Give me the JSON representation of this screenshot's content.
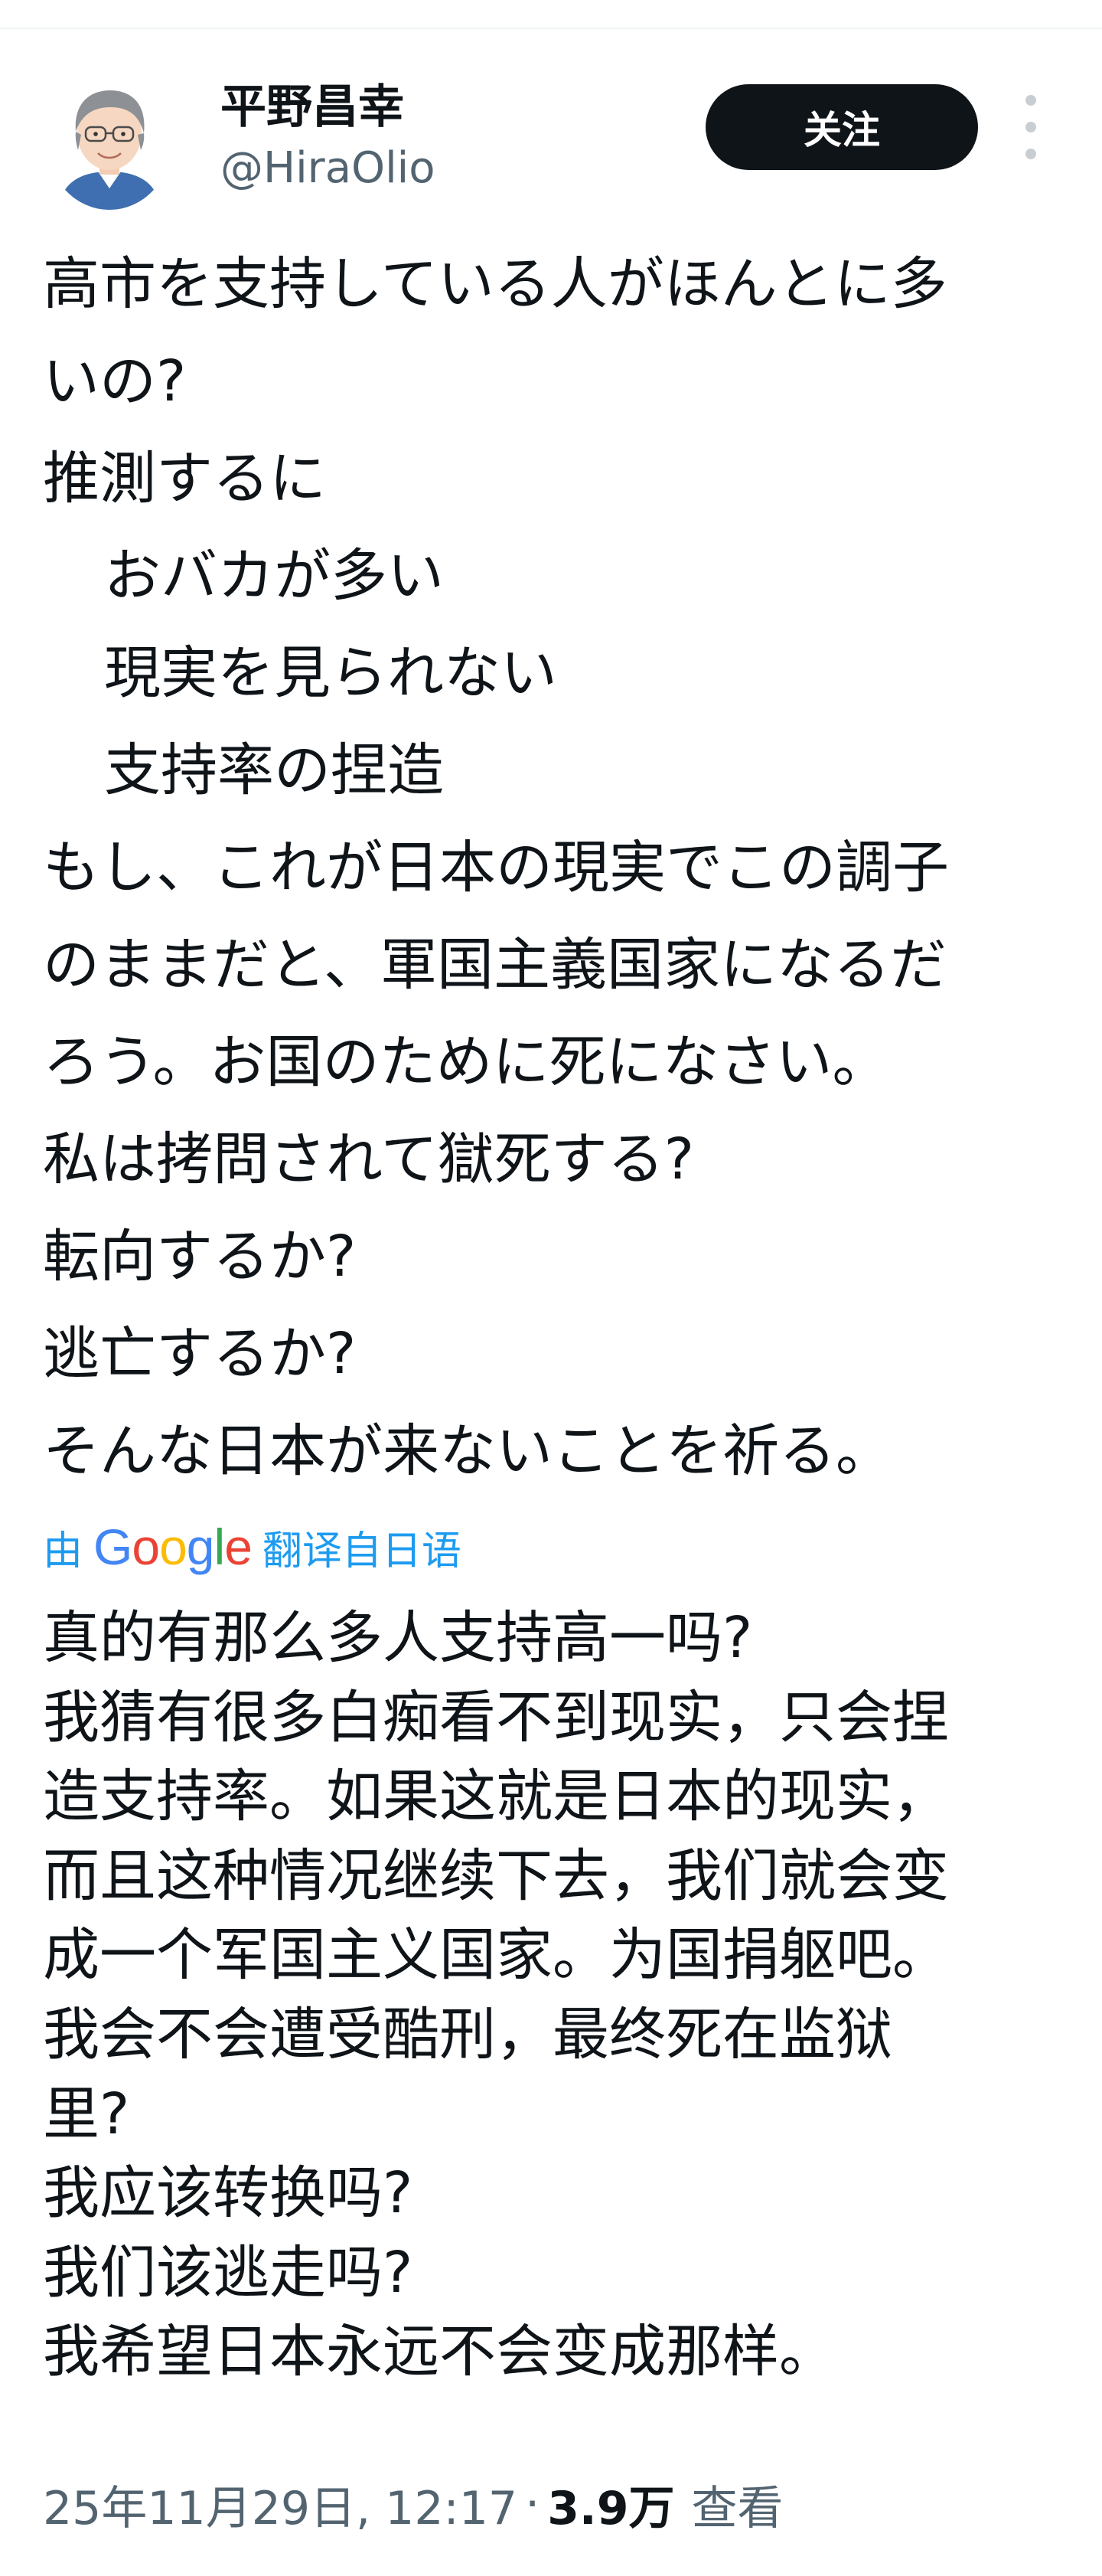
{
  "author": {
    "display_name": "平野昌幸",
    "handle": "@HiraOlio"
  },
  "actions": {
    "follow_label": "关注"
  },
  "post": {
    "original_lines": [
      {
        "text": "高市を支持している人がほんとに多",
        "indent": false
      },
      {
        "text": "いの?",
        "indent": false
      },
      {
        "text": "推測するに",
        "indent": false
      },
      {
        "text": "おバカが多い",
        "indent": true
      },
      {
        "text": "現実を見られない",
        "indent": true
      },
      {
        "text": "支持率の捏造",
        "indent": true
      },
      {
        "text": "もし、これが日本の現実でこの調子",
        "indent": false
      },
      {
        "text": "のままだと、軍国主義国家になるだ",
        "indent": false
      },
      {
        "text": "ろう。お国のために死になさい。",
        "indent": false
      },
      {
        "text": "私は拷問されて獄死する?",
        "indent": false
      },
      {
        "text": "転向するか?",
        "indent": false
      },
      {
        "text": "逃亡するか?",
        "indent": false
      },
      {
        "text": "そんな日本が来ないことを祈る。",
        "indent": false
      }
    ],
    "translation_prefix": "由",
    "translation_provider": "Google",
    "translation_suffix": "翻译自日语",
    "translated_lines": [
      "真的有那么多人支持高一吗?",
      "我猜有很多白痴看不到现实，只会捏",
      "造支持率。如果这就是日本的现实，",
      "而且这种情况继续下去，我们就会变",
      "成一个军国主义国家。为国捐躯吧。",
      "我会不会遭受酷刑，最终死在监狱",
      "里?",
      "我应该转换吗?",
      "我们该逃走吗?",
      "我希望日本永远不会变成那样。"
    ]
  },
  "meta": {
    "timestamp": "25年11月29日, 12:17",
    "separator": "·",
    "view_count": "3.9万",
    "views_label": "查看"
  },
  "colors": {
    "text_primary": "#0f1419",
    "text_secondary": "#536471",
    "link_blue": "#1d9bf0",
    "button_dark": "#0f1419",
    "divider": "#eff3f4"
  },
  "icons": {
    "avatar": "illustrated-portrait-avatar",
    "more": "vertical-ellipsis-icon",
    "translation_logo": "google-logo"
  }
}
